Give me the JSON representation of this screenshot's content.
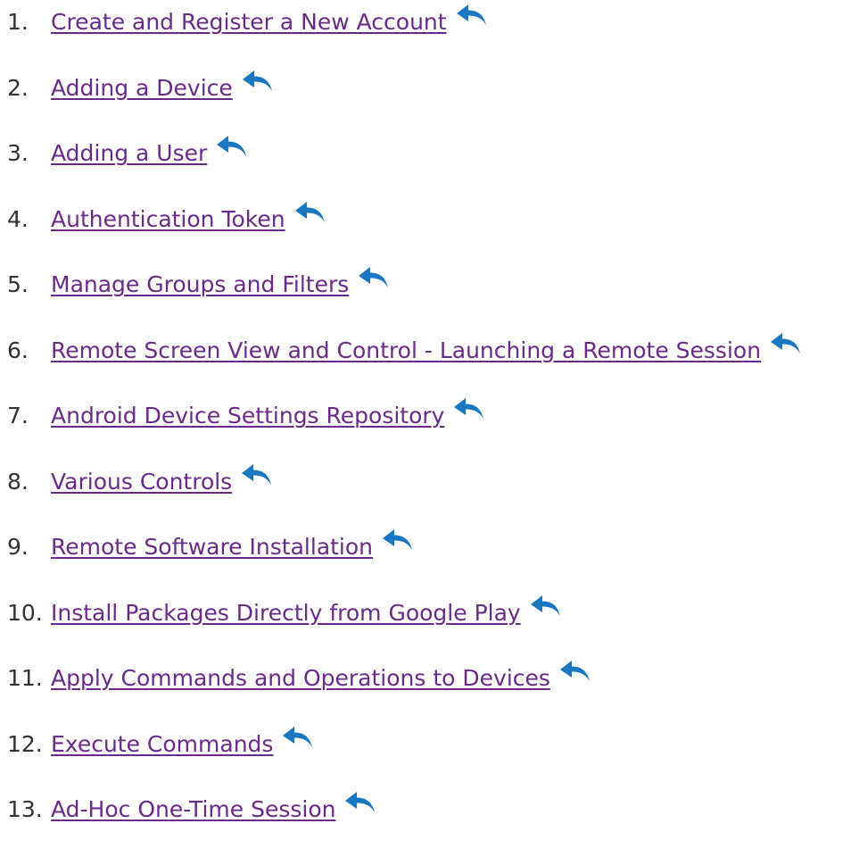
{
  "colors": {
    "link": "#6a2a8a",
    "number": "#333333",
    "back_arrow": "#1a78c2"
  },
  "back_icon": "reply-arrow-icon",
  "items": [
    {
      "number": "1.",
      "label": "Create and Register a New Account"
    },
    {
      "number": "2.",
      "label": "Adding a Device"
    },
    {
      "number": "3.",
      "label": "Adding a User"
    },
    {
      "number": "4.",
      "label": "Authentication Token"
    },
    {
      "number": "5.",
      "label": "Manage Groups and Filters"
    },
    {
      "number": "6.",
      "label": "Remote Screen View and Control - Launching a Remote Session "
    },
    {
      "number": "7.",
      "label": "Android Device Settings Repository"
    },
    {
      "number": "8.",
      "label": "Various Controls"
    },
    {
      "number": "9.",
      "label": "Remote Software Installation"
    },
    {
      "number": "10.",
      "label": "Install Packages Directly from Google Play"
    },
    {
      "number": "11.",
      "label": "Apply Commands and Operations to Devices"
    },
    {
      "number": "12.",
      "label": "Execute Commands"
    },
    {
      "number": "13.",
      "label": "Ad-Hoc One-Time Session"
    }
  ]
}
